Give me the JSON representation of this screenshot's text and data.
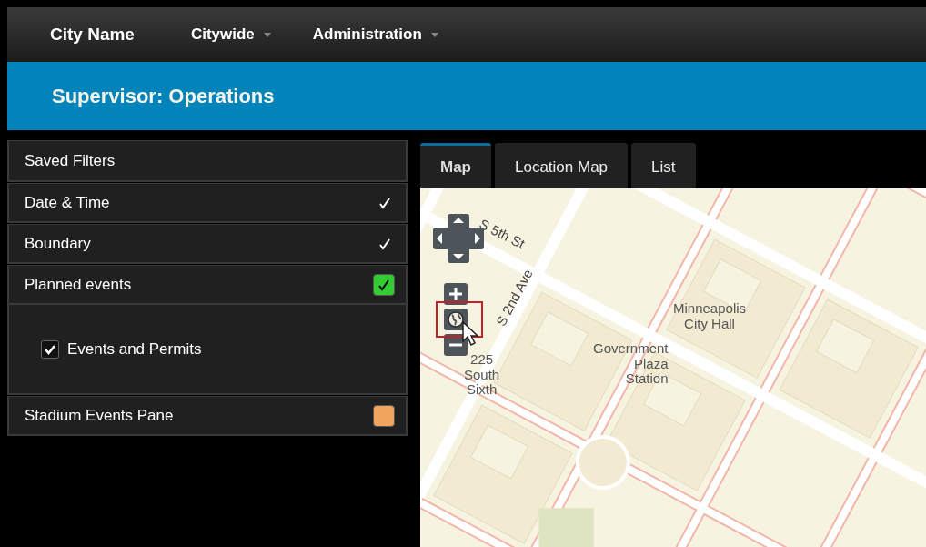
{
  "nav": {
    "brand": "City Name",
    "menus": [
      {
        "label": "Citywide"
      },
      {
        "label": "Administration"
      }
    ]
  },
  "header": {
    "title": "Supervisor: Operations"
  },
  "filters": [
    {
      "label": "Saved Filters",
      "kind": "plain"
    },
    {
      "label": "Date & Time",
      "kind": "tick",
      "checked": true
    },
    {
      "label": "Boundary",
      "kind": "tick",
      "checked": true
    },
    {
      "label": "Planned events",
      "kind": "swatch",
      "checked": true,
      "color": "#33cc33",
      "children": [
        {
          "label": "Events and Permits",
          "checked": true
        }
      ]
    },
    {
      "label": "Stadium Events Pane",
      "kind": "swatch",
      "checked": false,
      "color": "#f0a45e"
    }
  ],
  "tabs": [
    {
      "label": "Map",
      "selected": true
    },
    {
      "label": "Location Map",
      "selected": false
    },
    {
      "label": "List",
      "selected": false
    }
  ],
  "map": {
    "labels": [
      {
        "text": "S 5th St",
        "kind": "street"
      },
      {
        "text": "S 2nd Ave",
        "kind": "street"
      },
      {
        "text": "Minneapolis City Hall",
        "kind": "place"
      },
      {
        "text": "Government Plaza Station",
        "kind": "place"
      },
      {
        "text": "225 South Sixth",
        "kind": "place"
      }
    ]
  }
}
